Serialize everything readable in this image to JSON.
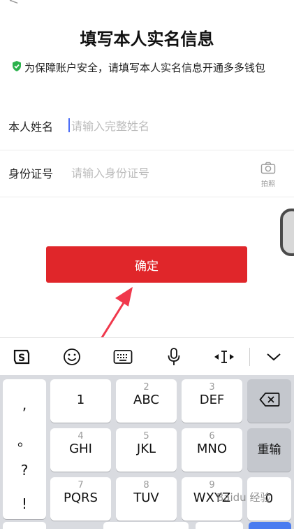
{
  "nav": {
    "back_glyph": "<"
  },
  "page": {
    "title": "填写本人实名信息",
    "notice": "为保障账户安全，请填写本人实名信息开通多多钱包"
  },
  "form": {
    "name_label": "本人姓名",
    "name_placeholder": "请输入完整姓名",
    "id_label": "身份证号",
    "id_placeholder": "请输入身份证号",
    "photo_caption": "拍照"
  },
  "confirm_label": "确定",
  "keyboard": {
    "toolbar": [
      "sogou-logo-icon",
      "emoji-icon",
      "keyboard-icon",
      "microphone-icon",
      "cursor-move-icon",
      "collapse-chevron-icon"
    ],
    "symbols": [
      ",",
      "。",
      "?",
      "!"
    ],
    "keys": [
      {
        "num": "",
        "letters": "1"
      },
      {
        "num": "2",
        "letters": "ABC"
      },
      {
        "num": "3",
        "letters": "DEF"
      },
      {
        "num": "4",
        "letters": "GHI"
      },
      {
        "num": "5",
        "letters": "JKL"
      },
      {
        "num": "6",
        "letters": "MNO"
      },
      {
        "num": "7",
        "letters": "PQRS"
      },
      {
        "num": "8",
        "letters": "TUV"
      },
      {
        "num": "9",
        "letters": "WXYZ"
      }
    ],
    "delete_icon": "backspace-icon",
    "reenter_label": "重输",
    "zero_label": "0"
  },
  "watermark": "Baidu 经验",
  "colors": {
    "primary": "#e0262a",
    "shield": "#2bb24c",
    "cursor": "#4a6cf7",
    "arrow": "#f0384c"
  }
}
